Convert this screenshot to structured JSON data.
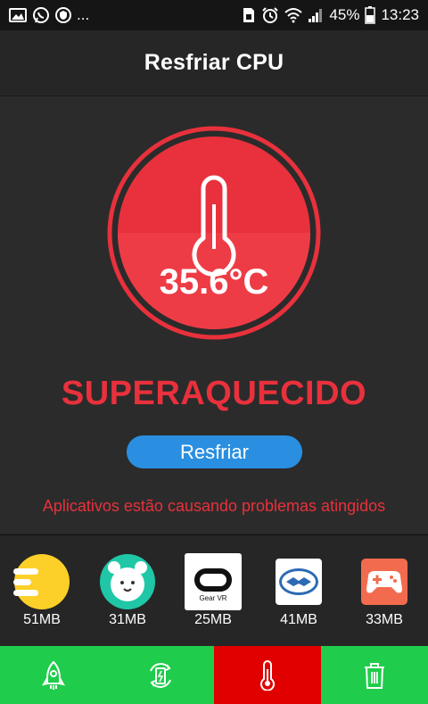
{
  "status_bar": {
    "dots": "...",
    "battery_percent": "45%",
    "time": "13:23",
    "left_icons": [
      "gallery-icon",
      "whatsapp-icon",
      "shield-icon"
    ],
    "right_icons": [
      "sim-icon",
      "alarm-icon",
      "wifi-icon",
      "signal-icon",
      "battery-icon"
    ]
  },
  "header": {
    "title": "Resfriar CPU"
  },
  "main": {
    "temperature": "35.6°C",
    "status": "SUPERAQUECIDO",
    "cool_button_label": "Resfriar",
    "warning": "Aplicativos estão causando problemas atingidos"
  },
  "apps": [
    {
      "icon": "yellow-app-icon",
      "size": "51MB"
    },
    {
      "icon": "alarm-clock-app-icon",
      "size": "31MB"
    },
    {
      "icon": "gear-vr-app-icon",
      "label": "Gear VR",
      "size": "25MB"
    },
    {
      "icon": "mercado-livre-app-icon",
      "size": "41MB"
    },
    {
      "icon": "game-controller-app-icon",
      "size": "33MB"
    }
  ],
  "bottom_nav": [
    {
      "icon": "rocket-icon",
      "active": false
    },
    {
      "icon": "battery-saver-icon",
      "active": false
    },
    {
      "icon": "thermometer-icon",
      "active": true
    },
    {
      "icon": "trash-icon",
      "active": false
    }
  ],
  "colors": {
    "accent_red": "#e8313c",
    "button_blue": "#2a8fe0",
    "nav_green": "#1fcc4b",
    "nav_active_red": "#e00000"
  }
}
